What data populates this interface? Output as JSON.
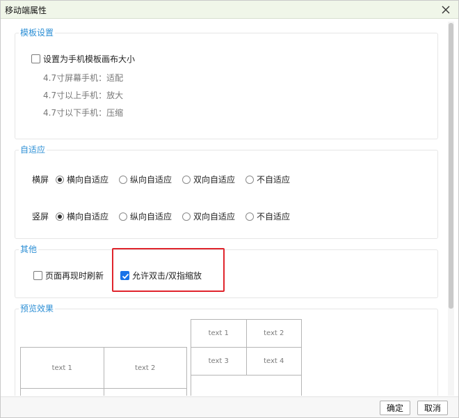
{
  "window": {
    "title": "移动端属性"
  },
  "template_group": {
    "title": "模板设置",
    "checkbox_label": "设置为手机模板画布大小",
    "checked": false,
    "notes": [
      "4.7寸屏幕手机：适配",
      "4.7寸以上手机：放大",
      "4.7寸以下手机：压缩"
    ]
  },
  "adaptive_group": {
    "title": "自适应",
    "rows": [
      {
        "label": "横屏",
        "options": [
          "横向自适应",
          "纵向自适应",
          "双向自适应",
          "不自适应"
        ],
        "selected": 0
      },
      {
        "label": "竖屏",
        "options": [
          "横向自适应",
          "纵向自适应",
          "双向自适应",
          "不自适应"
        ],
        "selected": 0
      }
    ]
  },
  "other_group": {
    "title": "其他",
    "refresh_label": "页面再现时刷新",
    "refresh_checked": false,
    "zoom_label": "允许双击/双指缩放",
    "zoom_checked": true
  },
  "preview_group": {
    "title": "预览效果",
    "table_left": [
      [
        "text 1",
        "text 2"
      ],
      [
        "",
        ""
      ]
    ],
    "table_right": [
      [
        "text 1",
        "text 2"
      ],
      [
        "text 3",
        "text 4"
      ]
    ]
  },
  "footer": {
    "ok_label": "确定",
    "cancel_label": "取消"
  },
  "colors": {
    "accent": "#2d8fd5",
    "highlight": "#e0242c",
    "check": "#1a73e8",
    "titlebar": "#f0f6e9"
  }
}
